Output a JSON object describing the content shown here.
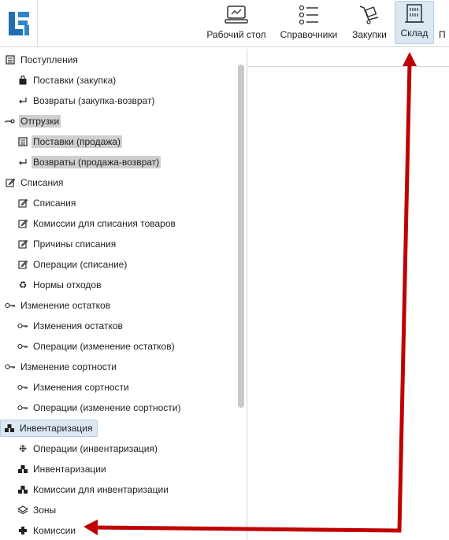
{
  "toolbar": {
    "items": [
      {
        "label": "Рабочий стол",
        "icon": "monitor-icon"
      },
      {
        "label": "Справочники",
        "icon": "list-icon"
      },
      {
        "label": "Закупки",
        "icon": "cart-icon"
      },
      {
        "label": "Склад",
        "icon": "warehouse-icon"
      },
      {
        "label": "П",
        "icon": "more-icon"
      }
    ]
  },
  "tree": {
    "groups": [
      {
        "label": "Поступления",
        "icon": "document-list-icon",
        "items": [
          {
            "label": "Поставки (закупка)",
            "icon": "bag-icon"
          },
          {
            "label": "Возвраты (закупка-возврат)",
            "icon": "return-arrow-icon"
          }
        ]
      },
      {
        "label": "Отгрузки",
        "icon": "truck-icon",
        "items": [
          {
            "label": "Поставки (продажа)",
            "icon": "document-list-icon"
          },
          {
            "label": "Возвраты (продажа-возврат)",
            "icon": "return-arrow-icon"
          }
        ]
      },
      {
        "label": "Списания",
        "icon": "edit-icon",
        "items": [
          {
            "label": "Списания",
            "icon": "edit-icon"
          },
          {
            "label": "Комиссии для списания товаров",
            "icon": "edit-icon"
          },
          {
            "label": "Причины списания",
            "icon": "edit-icon"
          },
          {
            "label": "Операции (списание)",
            "icon": "edit-icon"
          },
          {
            "label": "Нормы отходов",
            "icon": "recycle-icon"
          }
        ]
      },
      {
        "label": "Изменение остатков",
        "icon": "key-icon",
        "items": [
          {
            "label": "Изменения остатков",
            "icon": "key-icon"
          },
          {
            "label": "Операции (изменение остатков)",
            "icon": "key-icon"
          }
        ]
      },
      {
        "label": "Изменение сортности",
        "icon": "key-icon",
        "items": [
          {
            "label": "Изменения сортности",
            "icon": "key-icon"
          },
          {
            "label": "Операции (изменение сортности)",
            "icon": "key-icon"
          }
        ]
      },
      {
        "label": "Инвентаризация",
        "icon": "boxes-icon",
        "items": [
          {
            "label": "Операции (инвентаризация)",
            "icon": "gear-icon"
          },
          {
            "label": "Инвентаризации",
            "icon": "boxes-icon"
          },
          {
            "label": "Комиссии для инвентаризации",
            "icon": "boxes-icon"
          },
          {
            "label": "Зоны",
            "icon": "layers-icon"
          },
          {
            "label": "Комиссии",
            "icon": "puzzle-icon"
          }
        ]
      }
    ]
  },
  "colors": {
    "accent_bg": "#dbe8f4",
    "accent_border": "#b8cde2",
    "annotation": "#c00000",
    "highlight": "#cfcfcf"
  }
}
